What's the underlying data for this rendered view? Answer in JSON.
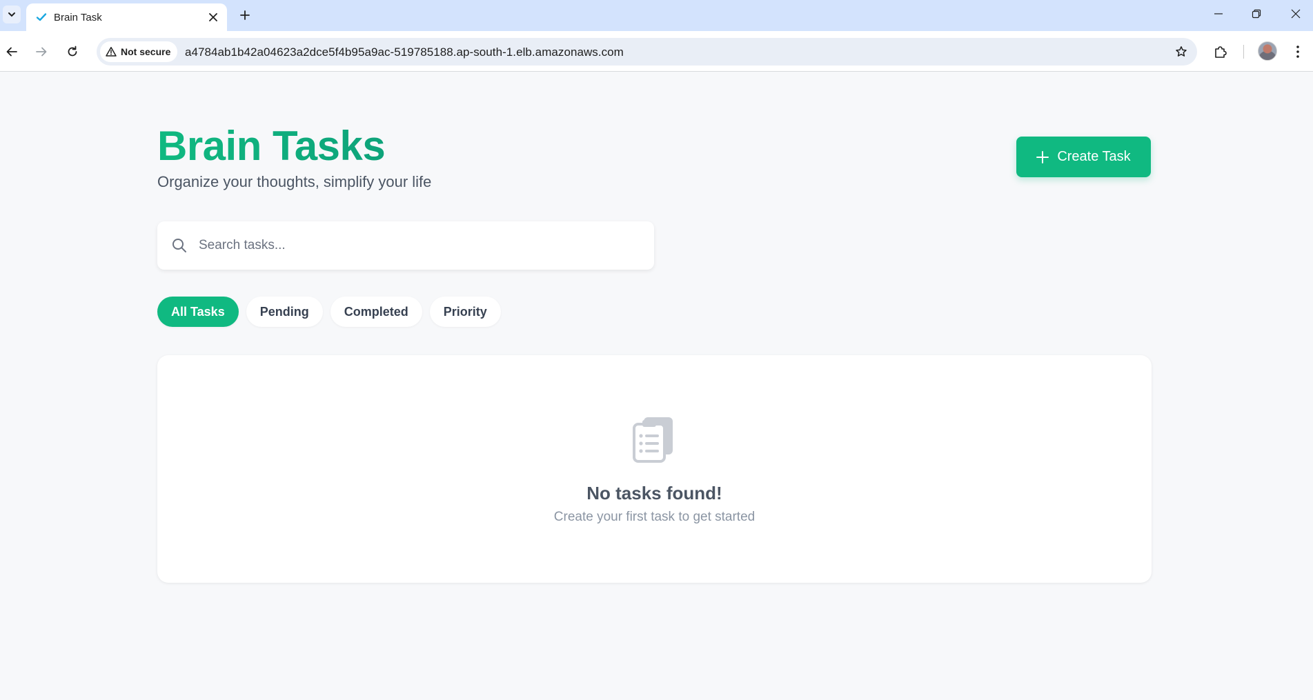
{
  "browser": {
    "tab_title": "Brain Task",
    "security_label": "Not secure",
    "url": "a4784ab1b42a04623a2dce5f4b95a9ac-519785188.ap-south-1.elb.amazonaws.com"
  },
  "header": {
    "title": "Brain Tasks",
    "subtitle": "Organize your thoughts, simplify your life",
    "create_button_label": "Create Task"
  },
  "search": {
    "placeholder": "Search tasks..."
  },
  "filters": [
    {
      "label": "All Tasks",
      "active": true
    },
    {
      "label": "Pending",
      "active": false
    },
    {
      "label": "Completed",
      "active": false
    },
    {
      "label": "Priority",
      "active": false
    }
  ],
  "empty_state": {
    "title": "No tasks found!",
    "subtitle": "Create your first task to get started"
  },
  "colors": {
    "accent": "#10b981",
    "tabstrip": "#d3e3fd"
  }
}
